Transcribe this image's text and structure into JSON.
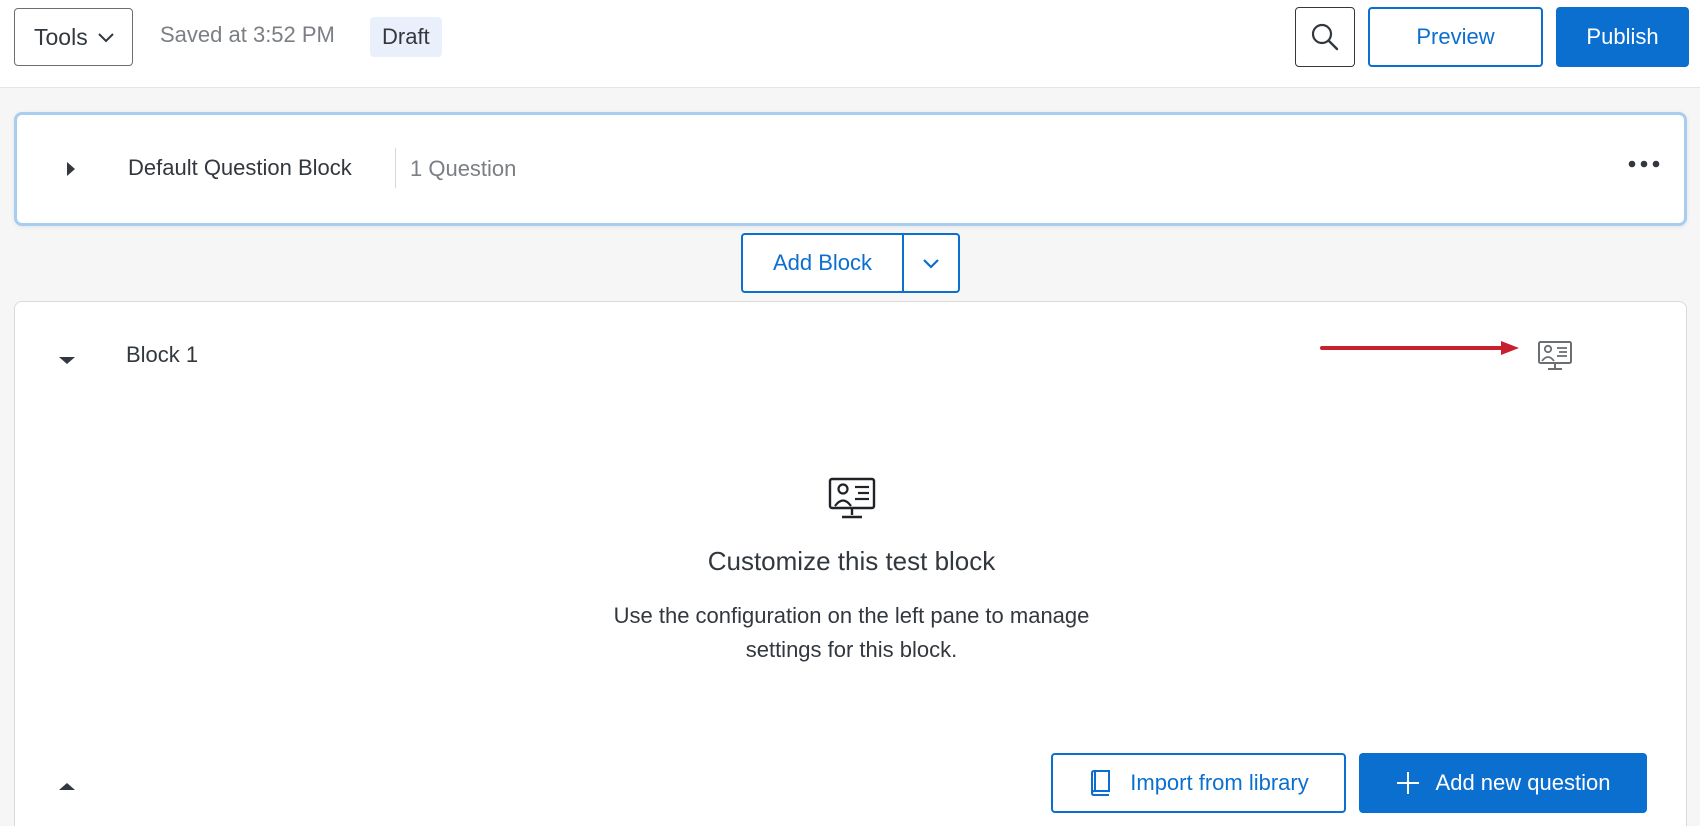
{
  "toolbar": {
    "tools_label": "Tools",
    "saved_status": "Saved at 3:52 PM",
    "draft_badge": "Draft",
    "preview_label": "Preview",
    "publish_label": "Publish",
    "search_icon": "search-icon"
  },
  "default_block": {
    "title": "Default Question Block",
    "question_count": "1 Question",
    "expanded": false,
    "more_icon": "more-horizontal-icon"
  },
  "add_block": {
    "label": "Add Block",
    "dropdown_icon": "chevron-down-icon"
  },
  "block1": {
    "title": "Block 1",
    "expanded": true,
    "header_icon": "test-block-icon",
    "empty_state": {
      "heading": "Customize this test block",
      "description": "Use the configuration on the left pane to manage settings for this block."
    },
    "import_label": "Import from library",
    "add_question_label": "Add new question"
  },
  "colors": {
    "accent": "#0b6fd0",
    "annotation_arrow": "#c8202f",
    "selected_border": "#a9cdef",
    "draft_bg": "#eaf0fb"
  }
}
